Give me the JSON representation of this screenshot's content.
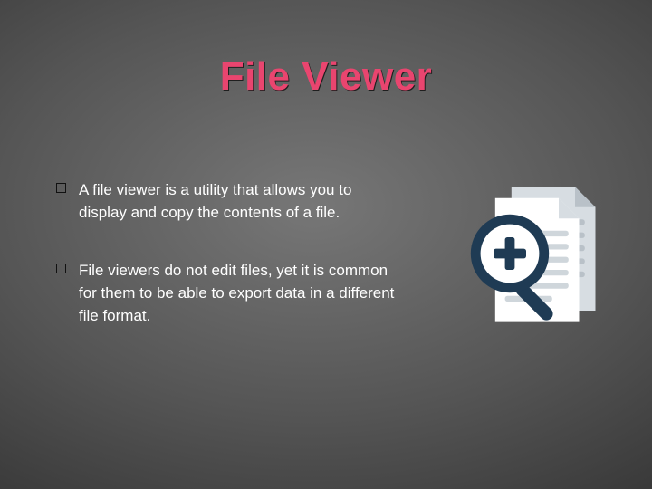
{
  "title": "File Viewer",
  "bullets": [
    "A file viewer is a utility that allows you to display and copy the contents of a file.",
    "File viewers do not edit files, yet it is common for them to be able to export data in a different file format."
  ]
}
